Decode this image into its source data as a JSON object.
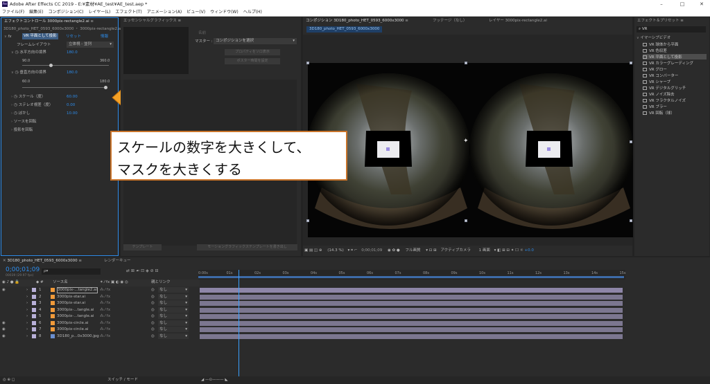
{
  "app": {
    "title": "Adobe After Effects CC 2019 - E:¥素材¥AE_test¥AE_test.aep *",
    "win_min": "–",
    "win_max": "□",
    "win_close": "✕"
  },
  "menu": [
    "ファイル(F)",
    "編集(E)",
    "コンポジション(C)",
    "レイヤー(L)",
    "エフェクト(T)",
    "アニメーション(A)",
    "ビュー(V)",
    "ウィンドウ(W)",
    "ヘルプ(H)"
  ],
  "effect_controls": {
    "tab": "エフェクトコントロール 3000pix-rectangle2.ai",
    "breadcrumb": "3D180_photo_HET_0593_6000x3000 ・ 3000pix-rectangle2.ai",
    "effect_name": "VR 平面として投影",
    "reset": "リセット",
    "about": "情報",
    "frame_layout_label": "フレームレイアウト",
    "frame_layout_value": "立体視 - 並列",
    "h_bound": "水平方向の境界",
    "h_bound_value": "180.0",
    "h_min": "90.0",
    "h_max": "360.0",
    "h_level": 0.33,
    "v_bound": "垂直方向の境界",
    "v_bound_value": "180.0",
    "v_min": "60.0",
    "v_max": "180.0",
    "v_level": 1.0,
    "scale_label": "スケール（度）",
    "scale_value": "60.00",
    "stereo_label": "ステレオ視差（度）",
    "stereo_value": "0.00",
    "blur_label": "ぼかし",
    "blur_value": "10.00",
    "src_rot": "ソースを回転",
    "proj_rot": "投影を回転"
  },
  "essential": {
    "tab": "エッセンシャルグラフィックス",
    "master_label": "マスター :",
    "name_label": "名前",
    "master_value": "コンポジションを選択",
    "btn1": "プロパティをソロ表示",
    "btn2": "ポスター時間を設定",
    "btn3": "モーショングラフィックステンプレートを書き出し",
    "btn4": "テンプレート"
  },
  "composition": {
    "tab": "コンポジション 3D180_photo_HET_0593_6000x3000",
    "footage_tab": "フッテージ（なし）",
    "layer_tab": "レイヤー 3000pix-rectangle2.ai",
    "subtab": "3D180_photo_HET_0593_6000x3000",
    "zoom": "(14.3 %)",
    "time": "0;00;01;09",
    "quality": "フル画質",
    "camera": "アクティブカメラ",
    "views": "1 画面",
    "exposure": "+0.0"
  },
  "annotation": {
    "line1": "スケールの数字を大きくして、",
    "line2": "マスクを大きくする"
  },
  "effects_presets": {
    "tab": "エフェクト＆プリセット",
    "search": "VR",
    "category": "イマーシブビデオ",
    "items": [
      "VR 球体から平面",
      "VR 色収差",
      "VR 平面として投影",
      "VR カラーグレーディング",
      "VR グロー",
      "VR コンバーター",
      "VR シャープ",
      "VR デジタルグリッチ",
      "VR ノイズ除去",
      "VR フラクタルノイズ",
      "VR ブラー",
      "VR 回転（球）"
    ],
    "selected_index": 2
  },
  "timeline": {
    "tab": "3D180_photo_HET_0593_6000x3000",
    "render_tab": "レンダーキュー",
    "timecode": "0;00;01;09",
    "frame_info": "00039 (29.97 fps)",
    "search_icon": "ρ▾",
    "col_source": "ソース名",
    "col_parent": "親とリンク",
    "ruler": [
      "0:00s",
      "01s",
      "02s",
      "03s",
      "04s",
      "05s",
      "06s",
      "07s",
      "08s",
      "09s",
      "10s",
      "11s",
      "12s",
      "13s",
      "14s",
      "15s"
    ],
    "playhead": 0.092,
    "layers": [
      {
        "num": "1",
        "name": "3000pix-...tangle2.ai",
        "parent": "なし",
        "vis": true
      },
      {
        "num": "2",
        "name": "3000pix-star.ai",
        "parent": "なし",
        "vis": false
      },
      {
        "num": "3",
        "name": "3000pix-star.ai",
        "parent": "なし",
        "vis": false
      },
      {
        "num": "4",
        "name": "3000pix-...tangle.ai",
        "parent": "なし",
        "vis": false
      },
      {
        "num": "5",
        "name": "3000pix-...tangle.ai",
        "parent": "なし",
        "vis": false
      },
      {
        "num": "6",
        "name": "3000pix-circle.ai",
        "parent": "なし",
        "vis": true
      },
      {
        "num": "7",
        "name": "3000pix-circle.ai",
        "parent": "なし",
        "vis": true
      },
      {
        "num": "8",
        "name": "3D180_p...0x3000.jpg",
        "parent": "なし",
        "vis": true
      }
    ],
    "switch_mode": "スイッチ / モード"
  }
}
